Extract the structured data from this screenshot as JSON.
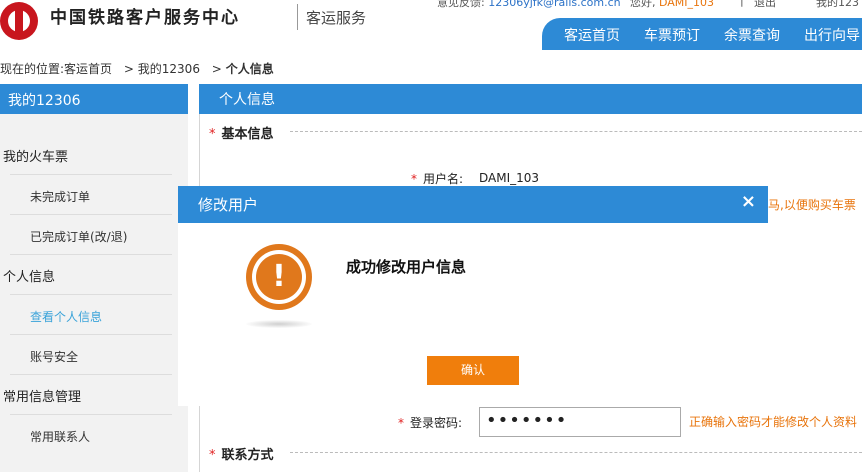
{
  "header": {
    "logo_title": "中国铁路客户服务中心",
    "logo_sub": "客运服务",
    "feedback_label": "意见反馈:",
    "feedback_email": "12306yjfk@rails.com.cn",
    "greeting": "您好,",
    "username": "DAMI_103",
    "divider": "|",
    "logout": "退出",
    "my12306_short": "我的123"
  },
  "nav": {
    "items": [
      "客运首页",
      "车票预订",
      "余票查询",
      "出行向导"
    ]
  },
  "breadcrumb": {
    "prefix": "现在的位置:",
    "item1": "客运首页",
    "sep1": ">",
    "item2": "我的12306",
    "sep2": ">",
    "current": "个人信息"
  },
  "sidebar": {
    "title": "我的12306",
    "group1": "我的火车票",
    "unfinished": "未完成订单",
    "finished": "已完成订单(改/退)",
    "group2": "个人信息",
    "view_info": "查看个人信息",
    "account_security": "账号安全",
    "group3": "常用信息管理",
    "contacts": "常用联系人"
  },
  "main": {
    "title": "个人信息",
    "basic_info": "基本信息",
    "req": "*",
    "username_label": "用户名:",
    "username_value": "DAMI_103",
    "hint_right": "马,以便购买车票",
    "password_label": "登录密码:",
    "password_value": "•••••••",
    "password_hint": "正确输入密码才能修改个人资料",
    "contact": "联系方式"
  },
  "modal": {
    "title": "修改用户",
    "close": "×",
    "icon_glyph": "!",
    "message": "成功修改用户信息",
    "confirm": "确认"
  },
  "colors": {
    "brand_blue": "#2d8ad6",
    "accent_orange": "#f07e0c",
    "logo_red": "#c8161e"
  }
}
